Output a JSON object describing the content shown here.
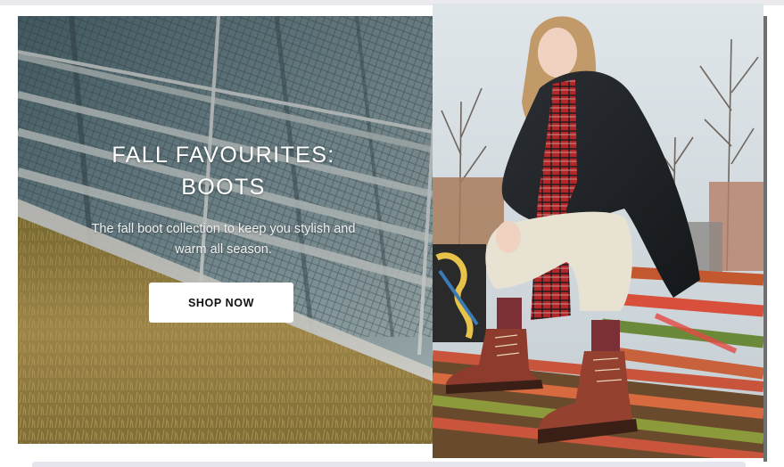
{
  "hero": {
    "title_line1": "FALL FAVOURITES:",
    "title_line2": "BOOTS",
    "subtitle": "The fall boot collection to keep you stylish and warm all season.",
    "cta_label": "SHOP NOW"
  },
  "images": {
    "left": "staircase-grass-photo",
    "right": "woman-boots-bench-photo"
  },
  "colors": {
    "cta_background": "#ffffff",
    "cta_text": "#111111",
    "title_text": "#ffffff"
  }
}
